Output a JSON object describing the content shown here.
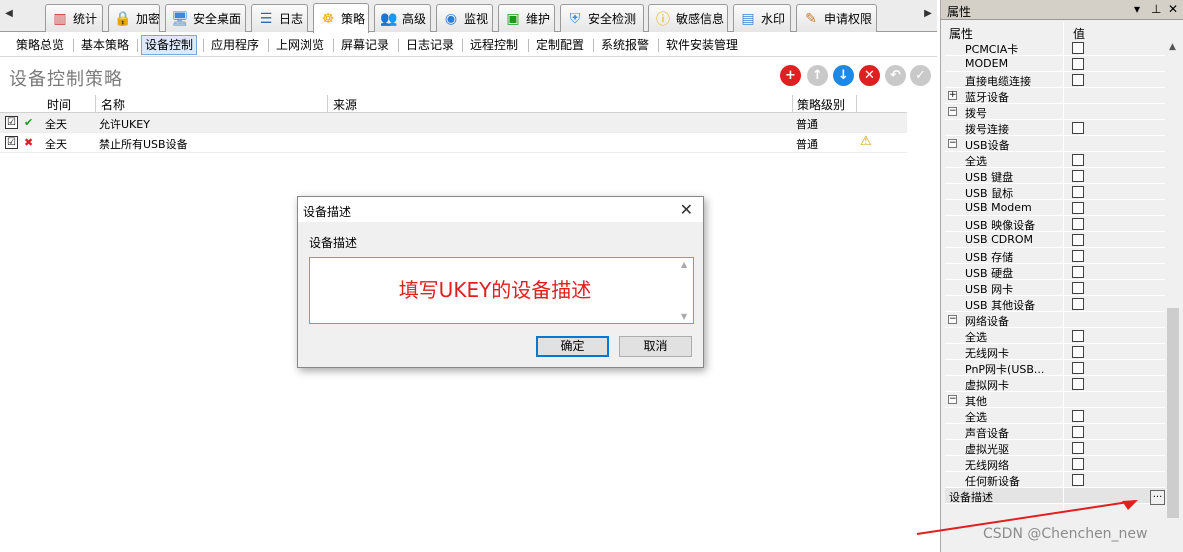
{
  "tabs": [
    {
      "label": "统计",
      "icon": "stats-icon"
    },
    {
      "label": "加密",
      "icon": "lock-icon"
    },
    {
      "label": "安全桌面",
      "icon": "desktop-icon"
    },
    {
      "label": "日志",
      "icon": "log-icon"
    },
    {
      "label": "策略",
      "icon": "policy-icon"
    },
    {
      "label": "高级",
      "icon": "users-icon"
    },
    {
      "label": "监视",
      "icon": "monitor-icon"
    },
    {
      "label": "维护",
      "icon": "maintenance-icon"
    },
    {
      "label": "安全检测",
      "icon": "security-check-icon"
    },
    {
      "label": "敏感信息",
      "icon": "sensitive-icon"
    },
    {
      "label": "水印",
      "icon": "watermark-icon"
    },
    {
      "label": "申请权限",
      "icon": "request-icon"
    }
  ],
  "active_tab": "策略",
  "subnav": [
    "策略总览",
    "基本策略",
    "设备控制",
    "应用程序",
    "上网浏览",
    "屏幕记录",
    "日志记录",
    "远程控制",
    "定制配置",
    "系统报警",
    "软件安装管理"
  ],
  "active_subnav": "设备控制",
  "page_title": "设备控制策略",
  "table": {
    "headers": [
      "时间",
      "名称",
      "来源",
      "策略级别"
    ],
    "rows": [
      {
        "checked": "☑",
        "status": "✔",
        "time": "全天",
        "name": "允许UKEY",
        "source": "",
        "level": "普通",
        "warning": ""
      },
      {
        "checked": "☑",
        "status": "✖",
        "time": "全天",
        "name": "禁止所有USB设备",
        "source": "",
        "level": "普通",
        "warning": "⚠"
      }
    ]
  },
  "dialog": {
    "title": "设备描述",
    "close": "✕",
    "label": "设备描述",
    "value": "填写UKEY的设备描述",
    "ok": "确定",
    "cancel": "取消"
  },
  "panel": {
    "title": "属性",
    "col_name": "属性",
    "col_value": "值",
    "rows": [
      {
        "label": "PCMCIA卡",
        "type": "item"
      },
      {
        "label": "MODEM",
        "type": "item"
      },
      {
        "label": "直接电缆连接",
        "type": "item"
      },
      {
        "label": "蓝牙设备",
        "type": "collapsed"
      },
      {
        "label": "拨号",
        "type": "group"
      },
      {
        "label": "拨号连接",
        "type": "item"
      },
      {
        "label": "USB设备",
        "type": "group"
      },
      {
        "label": "全选",
        "type": "item"
      },
      {
        "label": "USB 键盘",
        "type": "item"
      },
      {
        "label": "USB 鼠标",
        "type": "item"
      },
      {
        "label": "USB Modem",
        "type": "item"
      },
      {
        "label": "USB 映像设备",
        "type": "item"
      },
      {
        "label": "USB CDROM",
        "type": "item"
      },
      {
        "label": "USB 存储",
        "type": "item"
      },
      {
        "label": "USB 硬盘",
        "type": "item"
      },
      {
        "label": "USB 网卡",
        "type": "item"
      },
      {
        "label": "USB 其他设备",
        "type": "item"
      },
      {
        "label": "网络设备",
        "type": "group"
      },
      {
        "label": "全选",
        "type": "item"
      },
      {
        "label": "无线网卡",
        "type": "item"
      },
      {
        "label": "PnP网卡(USB...",
        "type": "item"
      },
      {
        "label": "虚拟网卡",
        "type": "item"
      },
      {
        "label": "其他",
        "type": "group"
      },
      {
        "label": "全选",
        "type": "item"
      },
      {
        "label": "声音设备",
        "type": "item"
      },
      {
        "label": "虚拟光驱",
        "type": "item"
      },
      {
        "label": "无线网络",
        "type": "item"
      },
      {
        "label": "任何新设备",
        "type": "item"
      },
      {
        "label": "设备描述",
        "type": "field"
      }
    ],
    "ellipsis": "..."
  },
  "watermark": "CSDN @Chenchen_new",
  "colors": {
    "accent": "#e0201e",
    "selection": "#dde9f8"
  }
}
